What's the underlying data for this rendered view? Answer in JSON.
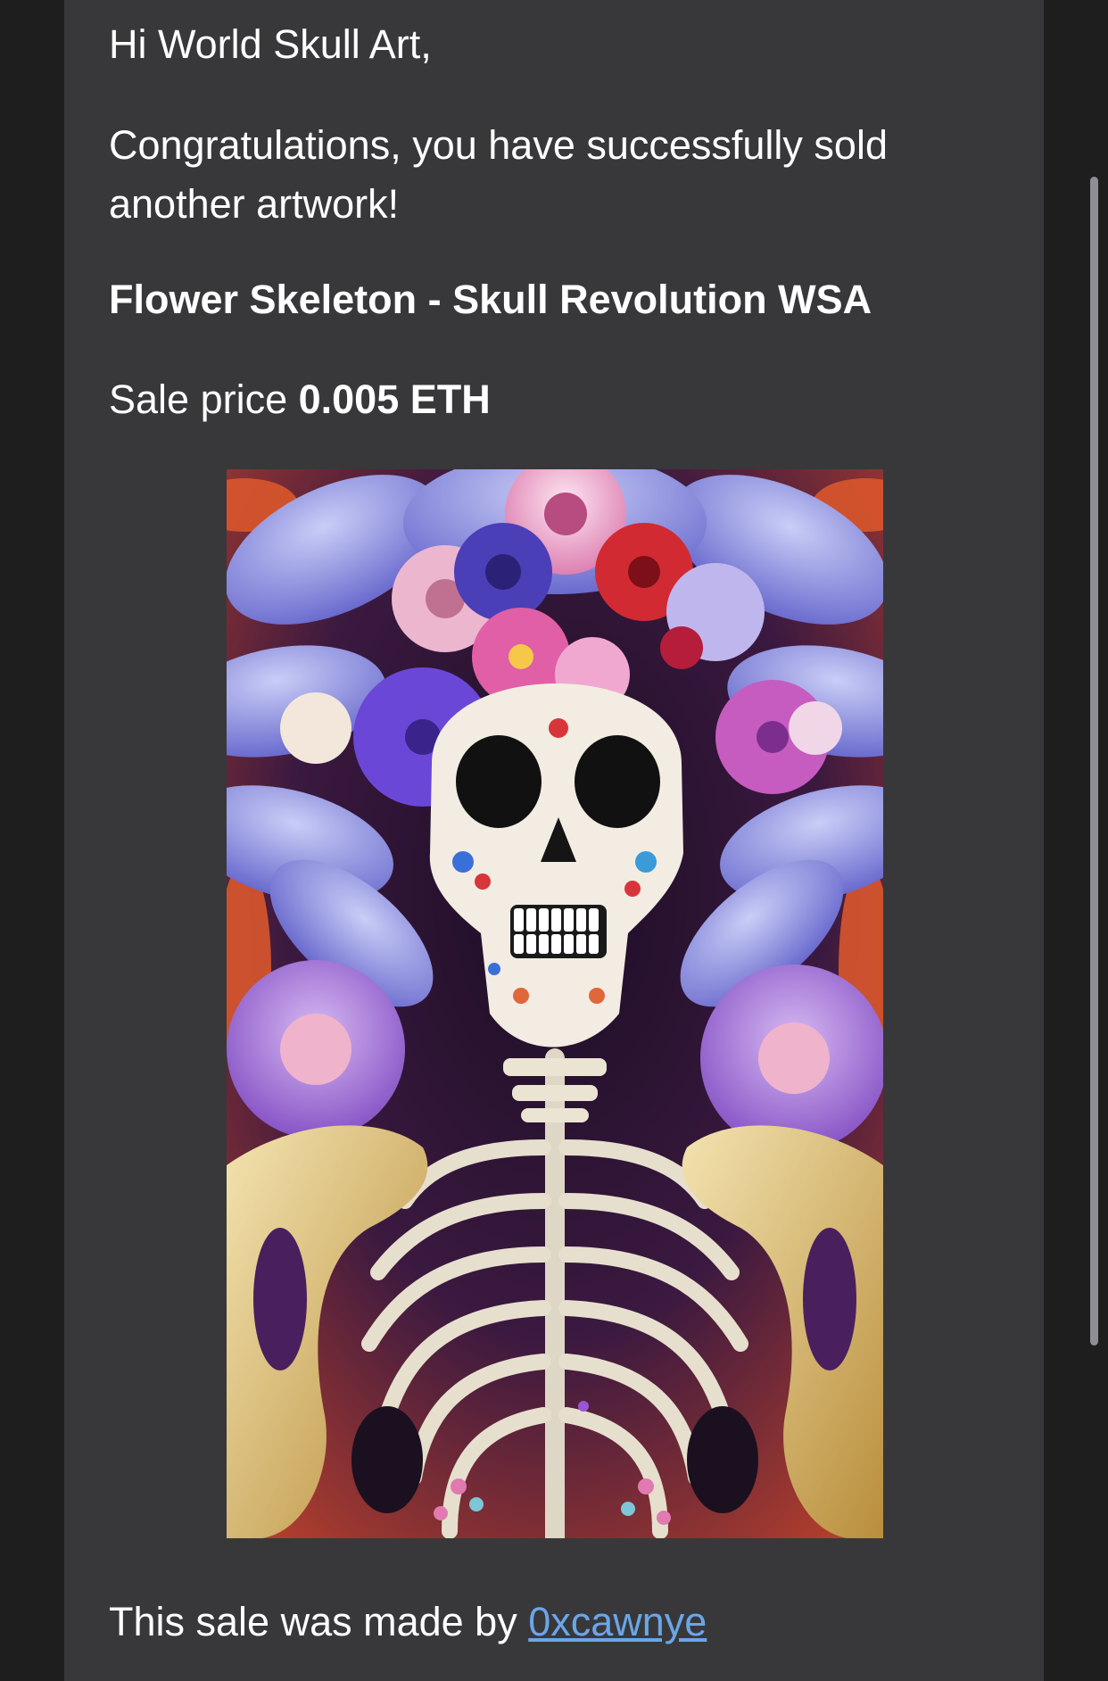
{
  "email": {
    "greeting": "Hi World Skull Art,",
    "congrats": "Congratulations, you have successfully sold another artwork!",
    "artwork_title": "Flower Skeleton - Skull Revolution WSA",
    "sale_price_label": "Sale price",
    "sale_price_value": "0.005 ETH",
    "seller_prefix": "This sale was made by",
    "seller_name": "0xcawnye"
  },
  "colors": {
    "page_background": "#1e1e1f",
    "card_background": "#38383a",
    "text": "#ffffff",
    "link": "#6aa6e8",
    "scrollbar": "#8e8e93"
  }
}
